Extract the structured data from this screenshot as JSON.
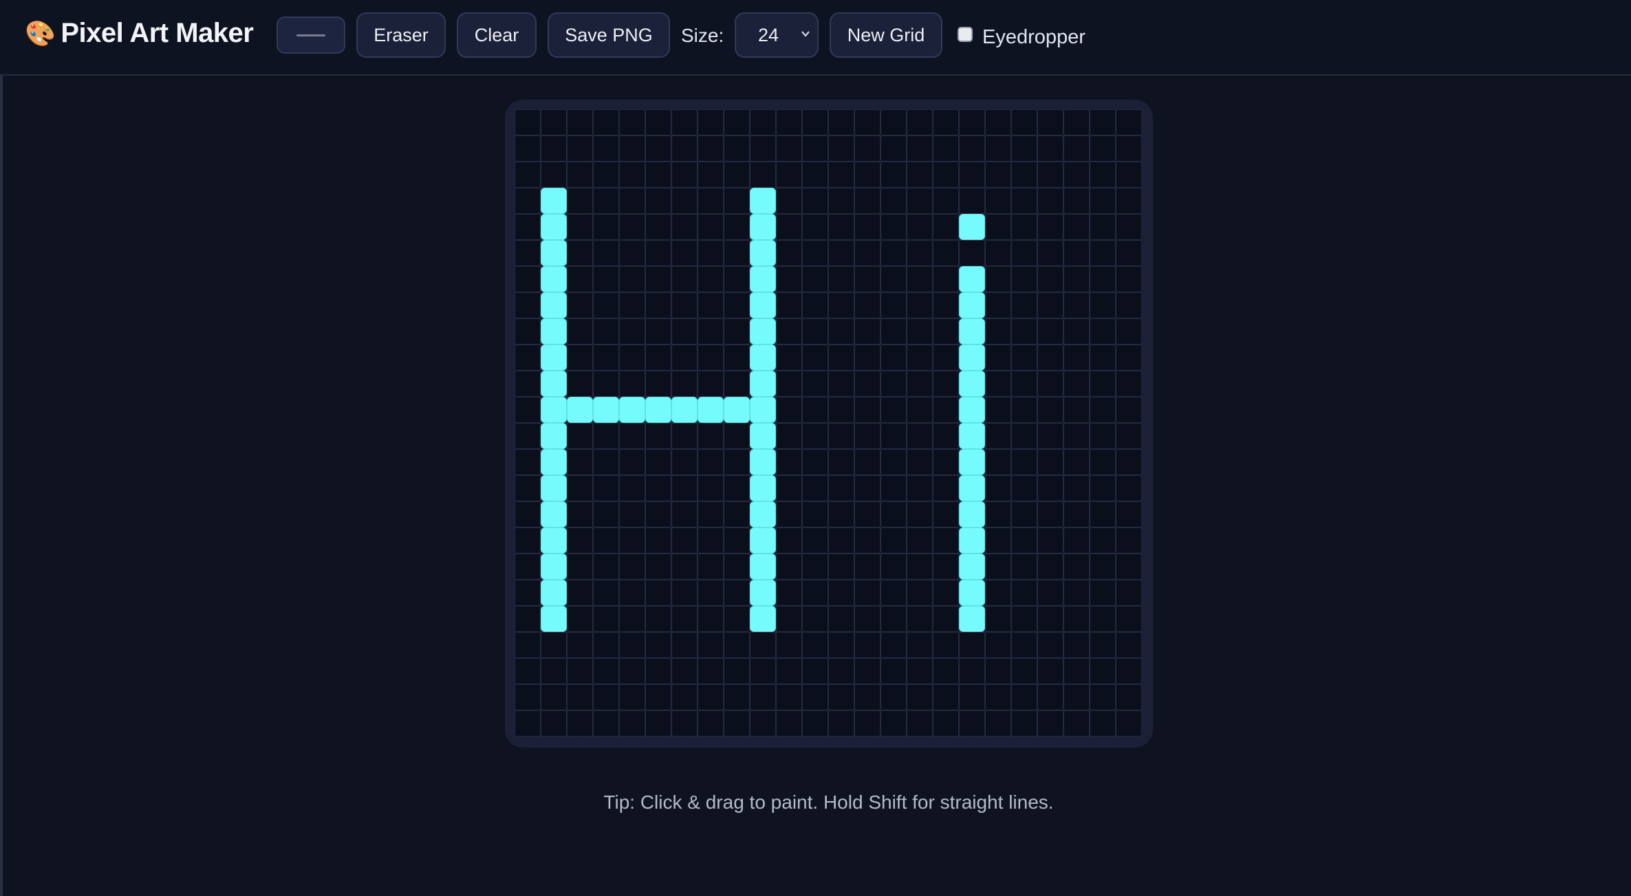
{
  "app": {
    "title": "Pixel Art Maker",
    "title_icon": "palette-icon"
  },
  "toolbar": {
    "color_value": "#75fbfb",
    "eraser_label": "Eraser",
    "clear_label": "Clear",
    "save_label": "Save PNG",
    "size_label": "Size:",
    "size_value": "24",
    "new_grid_label": "New Grid",
    "eyedropper_label": "Eyedropper",
    "eyedropper_checked": false
  },
  "canvas": {
    "grid_size": 24,
    "paint_color": "#75fbfb",
    "painted_cells": [
      [
        3,
        1
      ],
      [
        4,
        1
      ],
      [
        5,
        1
      ],
      [
        6,
        1
      ],
      [
        7,
        1
      ],
      [
        8,
        1
      ],
      [
        9,
        1
      ],
      [
        10,
        1
      ],
      [
        11,
        1
      ],
      [
        12,
        1
      ],
      [
        13,
        1
      ],
      [
        14,
        1
      ],
      [
        15,
        1
      ],
      [
        16,
        1
      ],
      [
        17,
        1
      ],
      [
        18,
        1
      ],
      [
        19,
        1
      ],
      [
        3,
        9
      ],
      [
        4,
        9
      ],
      [
        5,
        9
      ],
      [
        6,
        9
      ],
      [
        7,
        9
      ],
      [
        8,
        9
      ],
      [
        9,
        9
      ],
      [
        10,
        9
      ],
      [
        11,
        9
      ],
      [
        12,
        9
      ],
      [
        13,
        9
      ],
      [
        14,
        9
      ],
      [
        15,
        9
      ],
      [
        16,
        9
      ],
      [
        17,
        9
      ],
      [
        18,
        9
      ],
      [
        19,
        9
      ],
      [
        11,
        2
      ],
      [
        11,
        3
      ],
      [
        11,
        4
      ],
      [
        11,
        5
      ],
      [
        11,
        6
      ],
      [
        11,
        7
      ],
      [
        11,
        8
      ],
      [
        4,
        17
      ],
      [
        6,
        17
      ],
      [
        7,
        17
      ],
      [
        8,
        17
      ],
      [
        9,
        17
      ],
      [
        10,
        17
      ],
      [
        11,
        17
      ],
      [
        12,
        17
      ],
      [
        13,
        17
      ],
      [
        14,
        17
      ],
      [
        15,
        17
      ],
      [
        16,
        17
      ],
      [
        17,
        17
      ],
      [
        18,
        17
      ],
      [
        19,
        17
      ]
    ]
  },
  "tip": "Tip: Click & drag to paint. Hold Shift for straight lines."
}
